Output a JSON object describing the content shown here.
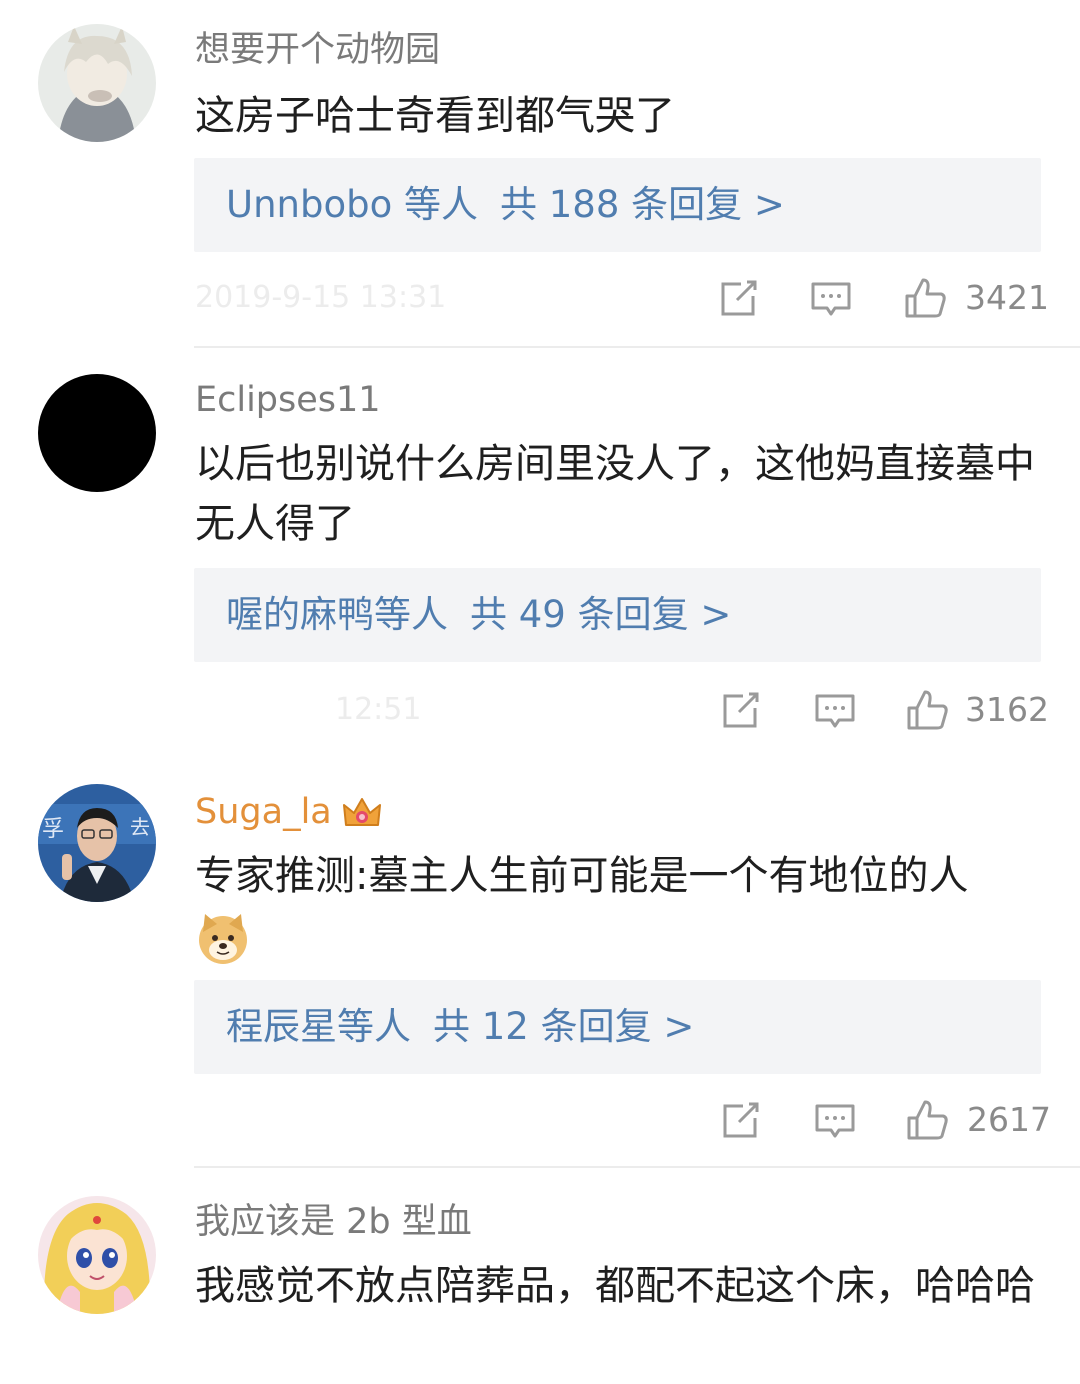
{
  "comments": [
    {
      "username": "想要开个动物园",
      "text": "这房子哈士奇看到都气哭了",
      "replies": {
        "users": "Unnbobo 等人",
        "count": "共 188 条回复 >"
      },
      "timestamp": "2019-9-15 13:31",
      "likes": "3421"
    },
    {
      "username": "Eclipses11",
      "text": "以后也别说什么房间里没人了，这他妈直接墓中无人得了",
      "replies": {
        "users": "喔的麻鸭等人",
        "count": "共 49 条回复 >"
      },
      "timestamp": "12:51",
      "likes": "3162"
    },
    {
      "username": "Suga_la",
      "text": "专家推测:墓主人生前可能是一个有地位的人",
      "replies": {
        "users": "程辰星等人",
        "count": "共 12 条回复 >"
      },
      "timestamp": "",
      "likes": "2617"
    },
    {
      "username": "我应该是 2b 型血",
      "text": "我感觉不放点陪葬品，都配不起这个床，哈哈哈"
    }
  ],
  "icons": {
    "share": "share-icon",
    "comment": "comment-icon",
    "like": "thumbs-up-icon",
    "crown": "crown-badge-icon",
    "emoji": "doge-emoji-icon"
  },
  "colors": {
    "link": "#507daf",
    "vip_name": "#e3903a",
    "meta": "#8a8a8a"
  }
}
